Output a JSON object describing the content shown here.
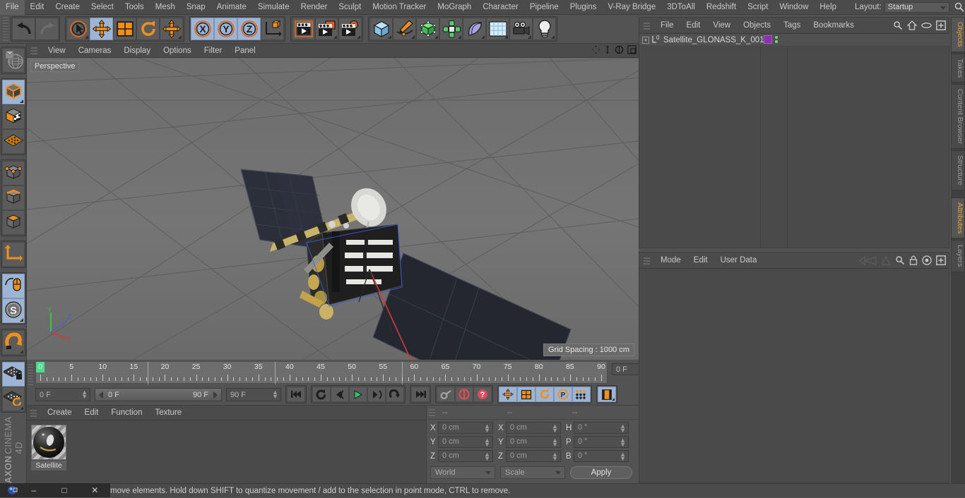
{
  "app": {
    "title": "CINEMA 4D",
    "brand_line1": "MAXON",
    "brand_line2": "CINEMA 4D"
  },
  "menubar": {
    "items": [
      "File",
      "Edit",
      "Create",
      "Select",
      "Tools",
      "Mesh",
      "Snap",
      "Animate",
      "Simulate",
      "Render",
      "Sculpt",
      "Motion Tracker",
      "MoGraph",
      "Character",
      "Pipeline",
      "Plugins",
      "V-Ray Bridge",
      "3DToAll",
      "Redshift",
      "Script",
      "Window",
      "Help"
    ],
    "layout_label": "Layout:",
    "layout_value": "Startup",
    "search_icon": "search-icon",
    "home_icon": "home-icon",
    "layout_icon": "layout-icon",
    "expand_icon": "expand-icon"
  },
  "toolbar": {
    "groups": [
      {
        "name": "undo-redo",
        "buttons": [
          {
            "name": "undo-button",
            "icon": "undo-icon",
            "active": false,
            "corner": false
          },
          {
            "name": "redo-button",
            "icon": "redo-icon",
            "active": false,
            "corner": false
          }
        ]
      },
      {
        "name": "transform-tools",
        "buttons": [
          {
            "name": "select-tool",
            "icon": "live-selection-icon",
            "active": false,
            "corner": true
          },
          {
            "name": "move-tool",
            "icon": "move-icon",
            "active": true,
            "corner": false
          },
          {
            "name": "scale-tool",
            "icon": "scale-icon",
            "active": false,
            "corner": false
          },
          {
            "name": "rotate-tool",
            "icon": "rotate-icon",
            "active": false,
            "corner": false
          },
          {
            "name": "world-move-tool",
            "icon": "move-icon",
            "active": false,
            "corner": true
          }
        ]
      },
      {
        "name": "axis-locks",
        "buttons": [
          {
            "name": "lock-x-axis",
            "icon": "x-axis-icon",
            "active": true,
            "corner": false
          },
          {
            "name": "lock-y-axis",
            "icon": "y-axis-icon",
            "active": true,
            "corner": false
          },
          {
            "name": "lock-z-axis",
            "icon": "z-axis-icon",
            "active": true,
            "corner": false
          },
          {
            "name": "world-object-axis",
            "icon": "world-axis-icon",
            "active": false,
            "corner": false
          }
        ]
      },
      {
        "name": "render-tools",
        "buttons": [
          {
            "name": "render-view-button",
            "icon": "render-view-icon",
            "active": false,
            "corner": false
          },
          {
            "name": "render-region-button",
            "icon": "render-region-icon",
            "active": false,
            "corner": true
          },
          {
            "name": "render-settings-button",
            "icon": "render-settings-icon",
            "active": false,
            "corner": true
          }
        ]
      },
      {
        "name": "object-creation",
        "buttons": [
          {
            "name": "add-cube-button",
            "icon": "cube-icon",
            "active": false,
            "corner": true
          },
          {
            "name": "add-spline-button",
            "icon": "pen-spline-icon",
            "active": false,
            "corner": true
          },
          {
            "name": "add-nurbs-button",
            "icon": "generator-icon",
            "active": false,
            "corner": true
          },
          {
            "name": "add-array-button",
            "icon": "array-icon",
            "active": false,
            "corner": true
          },
          {
            "name": "add-deformer-button",
            "icon": "bend-deformer-icon",
            "active": false,
            "corner": true
          },
          {
            "name": "add-scene-button",
            "icon": "floor-scene-icon",
            "active": false,
            "corner": true
          },
          {
            "name": "add-camera-button",
            "icon": "camera-icon",
            "active": false,
            "corner": true
          },
          {
            "name": "add-light-button",
            "icon": "light-bulb-icon",
            "active": false,
            "corner": true
          }
        ]
      }
    ]
  },
  "lefttoolbar": {
    "groups": [
      {
        "buttons": [
          {
            "name": "make-editable-button",
            "icon": "make-editable-icon",
            "active": false,
            "corner": false
          }
        ]
      },
      {
        "buttons": [
          {
            "name": "model-mode-button",
            "icon": "model-mode-icon",
            "active": true,
            "corner": true
          },
          {
            "name": "texture-mode-button",
            "icon": "texture-mode-icon",
            "active": false,
            "corner": false
          },
          {
            "name": "workplane-button",
            "icon": "workplane-icon",
            "active": false,
            "corner": false
          }
        ]
      },
      {
        "buttons": [
          {
            "name": "points-mode-button",
            "icon": "points-mode-icon",
            "active": false,
            "corner": false
          },
          {
            "name": "edges-mode-button",
            "icon": "edges-mode-icon",
            "active": false,
            "corner": false
          },
          {
            "name": "polygons-mode-button",
            "icon": "polygons-mode-icon",
            "active": false,
            "corner": false
          }
        ]
      },
      {
        "buttons": [
          {
            "name": "object-axis-button",
            "icon": "object-axis-icon",
            "active": false,
            "corner": false
          }
        ]
      },
      {
        "buttons": [
          {
            "name": "enable-axis-button",
            "icon": "mouse-axis-icon",
            "active": true,
            "corner": false
          },
          {
            "name": "soft-selection-button",
            "icon": "soft-selection-icon",
            "active": true,
            "corner": true
          }
        ]
      },
      {
        "buttons": [
          {
            "name": "snap-magnet-button",
            "icon": "magnet-icon",
            "active": false,
            "corner": true
          }
        ]
      },
      {
        "buttons": [
          {
            "name": "workplane-lock-button",
            "icon": "workplane-lock-icon",
            "active": true,
            "corner": false
          },
          {
            "name": "planar-workplane-button",
            "icon": "workplane-rotate-icon",
            "active": false,
            "corner": true
          }
        ]
      }
    ]
  },
  "viewport": {
    "menu_items": [
      "View",
      "Cameras",
      "Display",
      "Options",
      "Filter",
      "Panel"
    ],
    "label": "Perspective",
    "grid_spacing": "Grid Spacing : 1000 cm",
    "axis": {
      "x": "X",
      "y": "Y",
      "z": "Z",
      "x_color": "#d33a3a",
      "y_color": "#3fc23f",
      "z_color": "#3b5fe0"
    },
    "corner_icons": [
      "pan-icon",
      "dolly-icon",
      "rotate-view-icon",
      "maximize-view-icon"
    ],
    "scene_object": "GLONASS-K satellite 3D model"
  },
  "timeline": {
    "tick_labels": [
      "0",
      "5",
      "10",
      "15",
      "20",
      "25",
      "30",
      "35",
      "40",
      "45",
      "50",
      "55",
      "60",
      "65",
      "70",
      "75",
      "80",
      "85",
      "90"
    ],
    "range_start": 0,
    "range_end": 90,
    "current_frame_field": "0 F",
    "start_field": "0 F",
    "preview_min": "0 F",
    "preview_max": "90 F",
    "end_field": "90 F",
    "playhead_frame": 0,
    "transport": [
      {
        "name": "go-to-start-button",
        "icon": "skip-start-icon"
      },
      {
        "name": "play-backwards-button",
        "icon": "loop-icon"
      },
      {
        "name": "previous-frame-button",
        "icon": "step-back-icon"
      },
      {
        "name": "play-forward-button",
        "icon": "play-icon"
      },
      {
        "name": "next-frame-button",
        "icon": "step-forward-icon"
      },
      {
        "name": "play-mode-button",
        "icon": "loop-mode-icon"
      },
      {
        "name": "go-to-end-button",
        "icon": "skip-end-icon"
      },
      {
        "name": "record-active-objects-button",
        "icon": "key-icon"
      },
      {
        "name": "autokeying-button",
        "icon": "autokey-icon"
      },
      {
        "name": "keyframe-selection-button",
        "icon": "question-icon"
      },
      {
        "name": "position-key-button",
        "icon": "move-icon"
      },
      {
        "name": "scale-key-button",
        "icon": "scale-icon"
      },
      {
        "name": "rotation-key-button",
        "icon": "rotate-icon"
      },
      {
        "name": "parameter-key-button",
        "icon": "p-circle-icon"
      },
      {
        "name": "pla-key-button",
        "icon": "point-level-anim-icon"
      },
      {
        "name": "timeline-filmstrip-button",
        "icon": "filmstrip-icon"
      }
    ]
  },
  "material_manager": {
    "menu_items": [
      "Create",
      "Edit",
      "Function",
      "Texture"
    ],
    "materials": [
      {
        "name": "Satellite"
      }
    ]
  },
  "coordinates": {
    "headers": [
      "--",
      "--",
      "--"
    ],
    "rows": [
      {
        "pos_label": "X",
        "pos_value": "0 cm",
        "size_label": "X",
        "size_value": "0 cm",
        "rot_label": "H",
        "rot_value": "0 °"
      },
      {
        "pos_label": "Y",
        "pos_value": "0 cm",
        "size_label": "Y",
        "size_value": "0 cm",
        "rot_label": "P",
        "rot_value": "0 °"
      },
      {
        "pos_label": "Z",
        "pos_value": "0 cm",
        "size_label": "Z",
        "size_value": "0 cm",
        "rot_label": "B",
        "rot_value": "0 °"
      }
    ],
    "coord_system": "World",
    "transform_mode": "Scale",
    "apply_label": "Apply"
  },
  "object_manager": {
    "menu_items": [
      "File",
      "Edit",
      "View",
      "Objects",
      "Tags",
      "Bookmarks"
    ],
    "icons": [
      "search-icon",
      "home-icon",
      "eye-icon",
      "expand-icon"
    ],
    "objects": [
      {
        "name": "Satellite_GLONASS_K_001",
        "layer_color": "#8a2fb0"
      }
    ]
  },
  "attribute_manager": {
    "menu_items": [
      "Mode",
      "Edit",
      "User Data"
    ],
    "icons": [
      "back-nav-icon",
      "up-nav-icon",
      "search-icon",
      "lock-icon",
      "target-icon",
      "expand-icon"
    ]
  },
  "right_tabs": {
    "top": [
      "Objects",
      "Takes",
      "Content Browser",
      "Structure"
    ],
    "top_active": "Objects",
    "bottom": [
      "Attributes",
      "Layers"
    ],
    "bottom_active": "Attributes"
  },
  "statusbar": {
    "message": "move elements. Hold down SHIFT to quantize movement / add to the selection in point mode, CTRL to remove.",
    "window_controls": {
      "minimize": "–",
      "maximize": "□",
      "close": "✕"
    }
  },
  "colors": {
    "accent_orange": "#e8a33d",
    "active_blue": "#9db4d4",
    "panel_bg": "#4a4a4a",
    "chrome_bg": "#535353",
    "viewport_bg": "#6f6f6f",
    "green_playhead": "#4ddc8f"
  }
}
